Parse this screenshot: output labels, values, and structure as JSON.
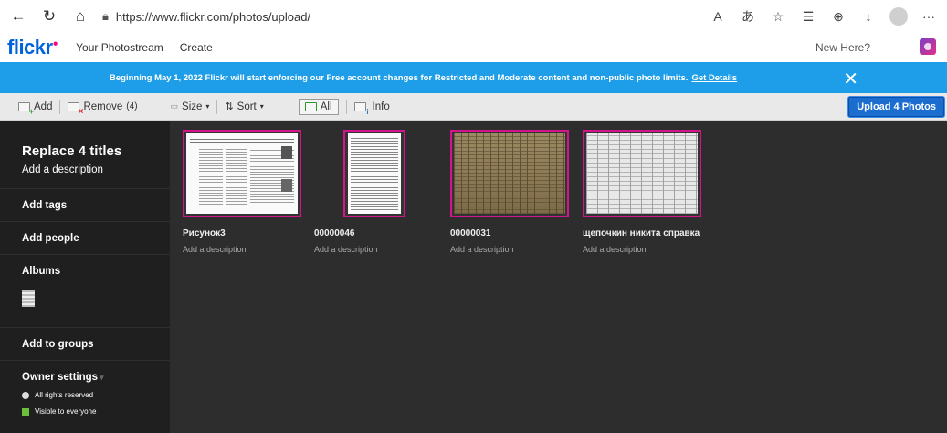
{
  "browser": {
    "url": "https://www.flickr.com/photos/upload/"
  },
  "header": {
    "logo": "flickr",
    "nav": [
      "Your Photostream",
      "Create"
    ],
    "new_here": "New Here?"
  },
  "banner": {
    "text": "Beginning May 1, 2022 Flickr will start enforcing our Free account changes for Restricted and Moderate content and non-public photo limits.",
    "link": "Get Details",
    "close": "✕"
  },
  "toolbar": {
    "add": "Add",
    "remove": "Remove",
    "remove_count": "(4)",
    "size": "Size",
    "sort": "Sort",
    "all": "All",
    "info": "Info",
    "upload": "Upload 4 Photos"
  },
  "sidebar": {
    "title": "Replace 4 titles",
    "add_description": "Add a description",
    "add_tags": "Add tags",
    "add_people": "Add people",
    "albums": "Albums",
    "add_to_groups": "Add to groups",
    "owner_settings": "Owner settings",
    "rights": "All rights reserved",
    "visibility": "Visible to everyone"
  },
  "photos": [
    {
      "title": "Рисунок3",
      "description": "Add a description"
    },
    {
      "title": "00000046",
      "description": "Add a description"
    },
    {
      "title": "00000031",
      "description": "Add a description"
    },
    {
      "title": "щепочкин никита справка",
      "description": "Add a description"
    }
  ]
}
